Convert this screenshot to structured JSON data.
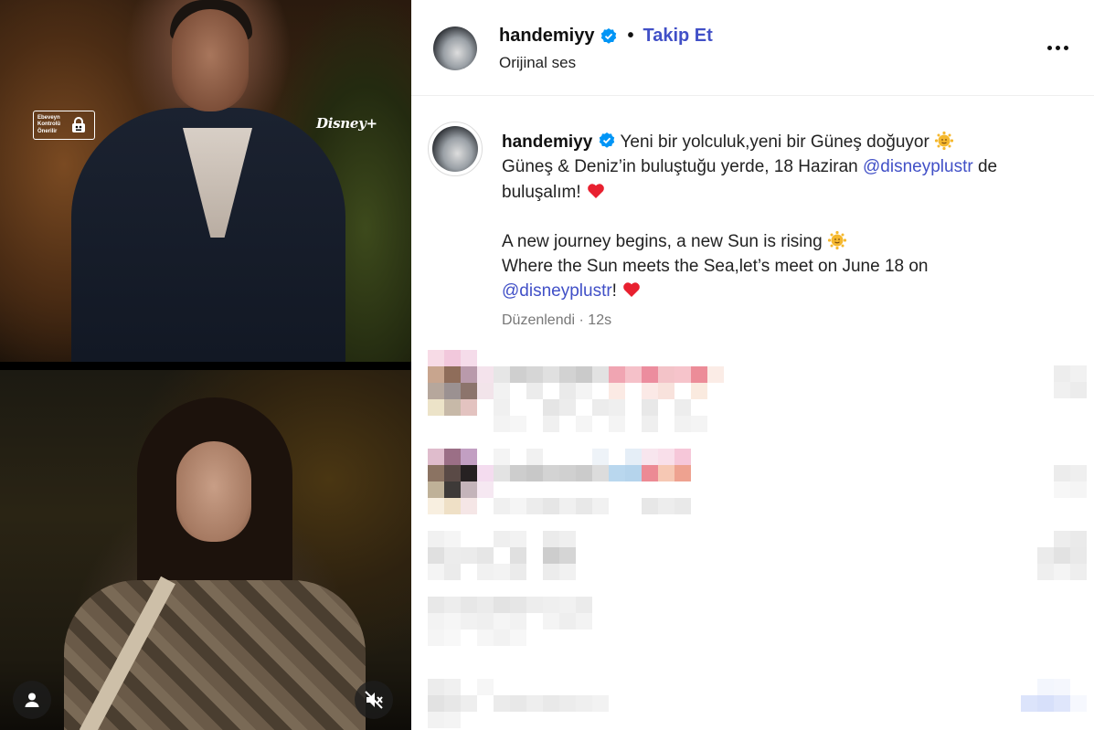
{
  "media": {
    "rating_badge": "Ebeveyn Kontrolü Önerilir",
    "brand_logo": "Disney+",
    "icons": {
      "rating": "lock-icon",
      "user": "user-icon",
      "mute": "muted-speaker-icon"
    }
  },
  "header": {
    "username": "handemiyy",
    "separator": "•",
    "follow_label": "Takip Et",
    "subtitle": "Orijinal ses",
    "more_icon": "more-horizontal-icon"
  },
  "caption": {
    "username": "handemiyy",
    "line1": "Yeni bir yolculuk,yeni bir Güneş doğuyor",
    "line2_pre": "Güneş & Deniz’in buluştuğu yerde, 18 Haziran",
    "mention1": "@disneyplustr",
    "line2_post": "de buluşalım!",
    "line3": "A new journey begins, a new Sun is rising",
    "line4": "Where the Sun meets the Sea,let’s meet on June 18 on",
    "mention2": "@disneyplustr",
    "line5_post": "!",
    "emojis": [
      "smiling-sun-icon",
      "red-heart-icon"
    ]
  },
  "meta": {
    "edited": "Düzenlendi",
    "separator": "·",
    "time": "12s"
  },
  "colors": {
    "link": "#4150c7",
    "verified": "#0095f6",
    "heart": "#e8202f",
    "muted_text": "#777777"
  }
}
